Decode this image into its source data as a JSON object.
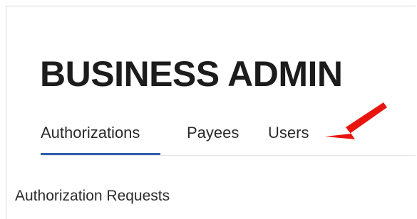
{
  "header": {
    "title": "BUSINESS ADMIN"
  },
  "tabs": [
    {
      "label": "Authorizations",
      "active": true
    },
    {
      "label": "Payees",
      "active": false
    },
    {
      "label": "Users",
      "active": false
    }
  ],
  "main": {
    "section_heading": "Authorization Requests"
  },
  "annotation": {
    "icon": "red-arrow-icon",
    "color": "#e8150f",
    "points_to": "Users"
  },
  "colors": {
    "active_tab_underline": "#2f5fb0",
    "title_text": "#1c1c1c"
  }
}
